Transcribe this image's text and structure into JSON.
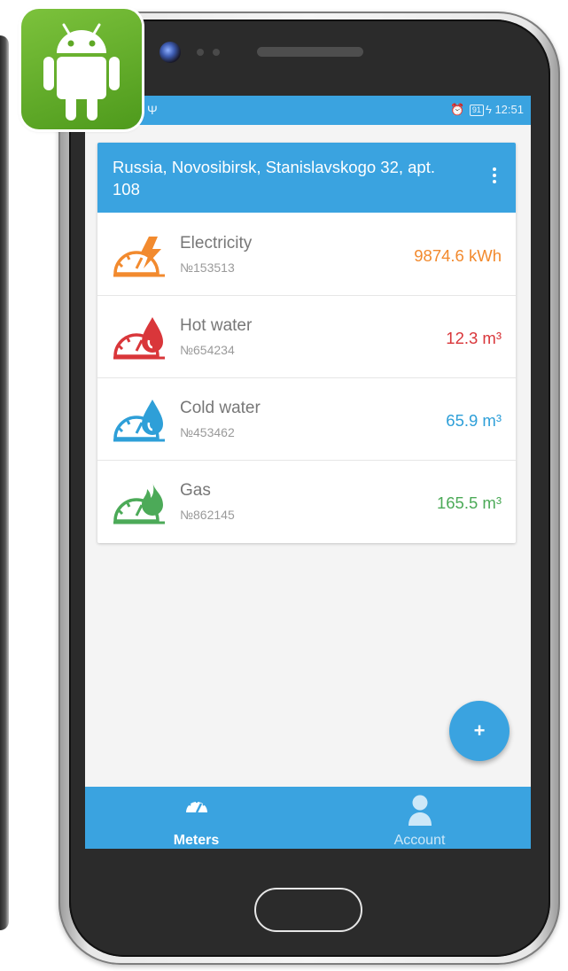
{
  "status_bar": {
    "usb_symbol": "✆",
    "usb_symbol_alt": "Ψ",
    "alarm_icon": "⏰",
    "battery": "91",
    "charging": "ϟ",
    "time": "12:51"
  },
  "card": {
    "address": "Russia, Novosibirsk, Stanislavskogo 32, apt. 108"
  },
  "meters": [
    {
      "icon": "electricity-meter-icon",
      "name": "Electricity",
      "number": "№153513",
      "value": "9874.6 kWh",
      "color": "#f28a2e"
    },
    {
      "icon": "hot-water-meter-icon",
      "name": "Hot water",
      "number": "№654234",
      "value": "12.3 m³",
      "color": "#d9363a"
    },
    {
      "icon": "cold-water-meter-icon",
      "name": "Cold water",
      "number": "№453462",
      "value": "65.9 m³",
      "color": "#2e9fd8"
    },
    {
      "icon": "gas-meter-icon",
      "name": "Gas",
      "number": "№862145",
      "value": "165.5 m³",
      "color": "#4caa58"
    }
  ],
  "fab": {
    "label": "+"
  },
  "bottom_nav": {
    "meters_label": "Meters",
    "account_label": "Account"
  },
  "colors": {
    "primary": "#3aa3e0",
    "android_green": "#6ab42f"
  }
}
